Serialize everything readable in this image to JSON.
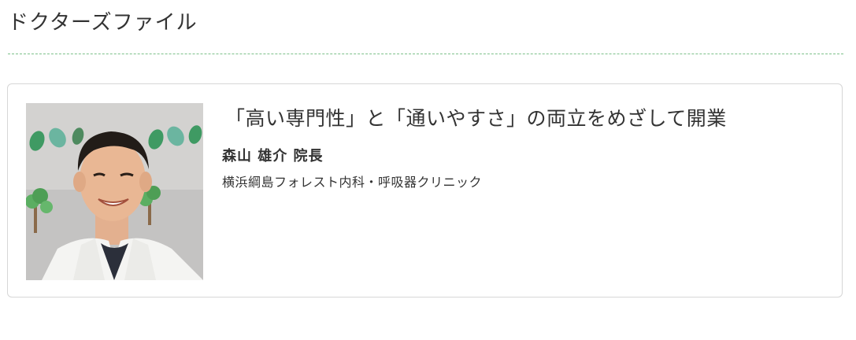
{
  "section": {
    "title": "ドクターズファイル"
  },
  "card": {
    "headline": "「高い専門性」と「通いやすさ」の両立をめざして開業",
    "doctor_name": "森山 雄介 院長",
    "clinic_name": "横浜綱島フォレスト内科・呼吸器クリニック",
    "photo_icon": "doctor-portrait"
  },
  "colors": {
    "divider": "#7cc08a",
    "card_border": "#d6d6d6",
    "text": "#333333",
    "leaf_green": "#4f9a5a"
  }
}
